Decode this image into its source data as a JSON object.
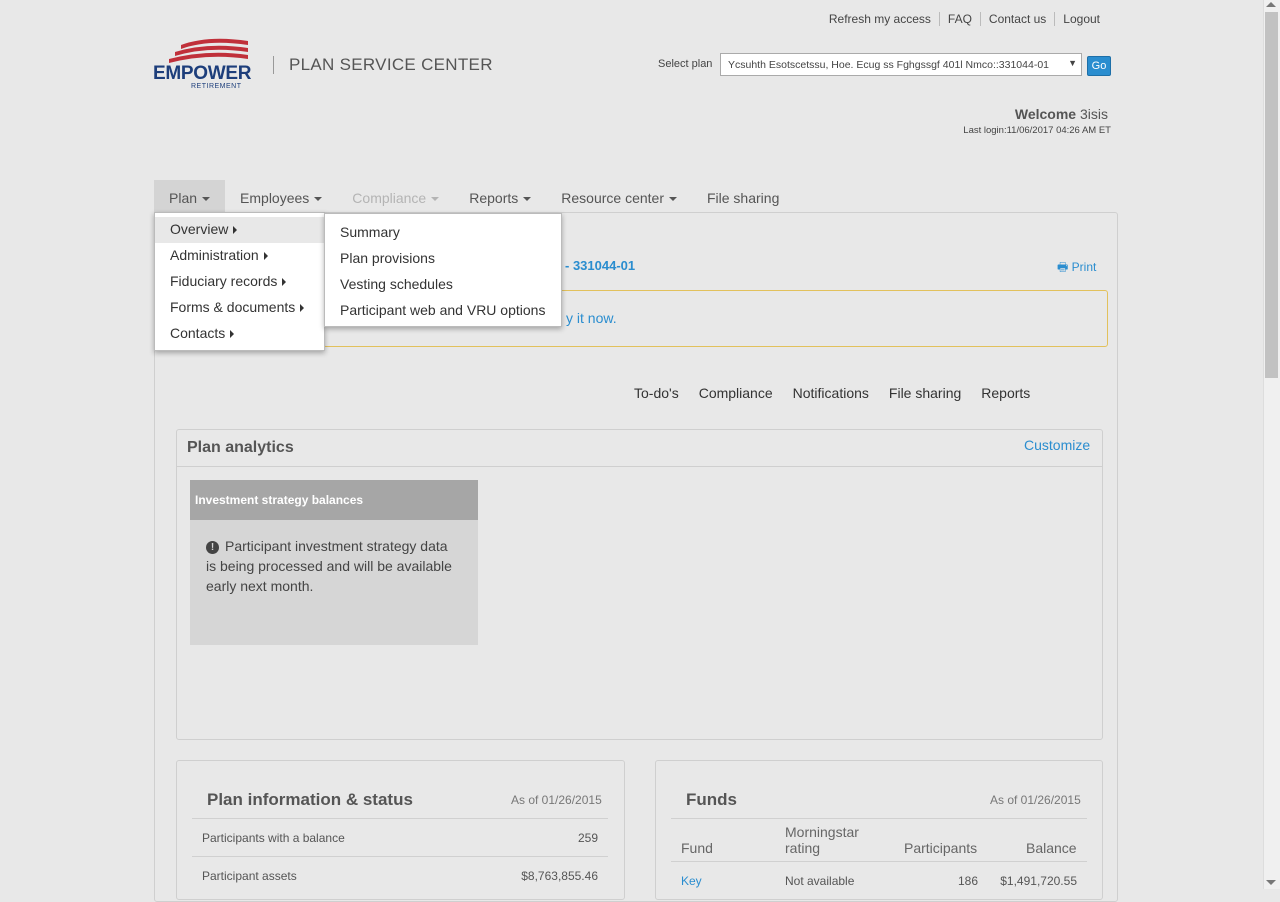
{
  "util_links": [
    "Refresh my access",
    "FAQ",
    "Contact us",
    "Logout"
  ],
  "brand": {
    "name": "EMPOWER",
    "sub": "RETIREMENT",
    "product": "PLAN SERVICE CENTER",
    "colors": {
      "navy": "#1d3e7b",
      "red": "#c0303a"
    }
  },
  "plan_select": {
    "label": "Select plan",
    "value": "Ycsuhth Esotscetssu, Hoe. Ecug ss Fghgssgf 401l Nmco::331044-01",
    "go": "Go"
  },
  "welcome": {
    "prefix": "Welcome",
    "user": "3isis",
    "last_login": "Last login:11/06/2017 04:26 AM ET"
  },
  "nav": [
    "Plan",
    "Employees",
    "Compliance",
    "Reports",
    "Resource center",
    "File sharing"
  ],
  "plan_id": "- 331044-01",
  "print": "Print",
  "alert_link": "y it now.",
  "subtabs": [
    "To-do's",
    "Compliance",
    "Notifications",
    "File sharing",
    "Reports"
  ],
  "analytics": {
    "title": "Plan analytics",
    "customize": "Customize",
    "card_title": "Investment strategy balances",
    "card_message": "Participant investment strategy data is being processed and will be available early next month."
  },
  "plan_info": {
    "title": "Plan information & status",
    "as_of": "As of 01/26/2015",
    "rows": [
      {
        "label": "Participants with a balance",
        "value": "259"
      },
      {
        "label": "Participant assets",
        "value": "$8,763,855.46"
      }
    ]
  },
  "funds": {
    "title": "Funds",
    "as_of": "As of 01/26/2015",
    "headers": {
      "fund": "Fund",
      "rating_1": "Morningstar",
      "rating_2": "rating",
      "participants": "Participants",
      "balance": "Balance"
    },
    "rows": [
      {
        "fund": "Key",
        "rating": "Not available",
        "participants": "186",
        "balance": "$1,491,720.55"
      }
    ]
  },
  "plan_menu": [
    "Overview",
    "Administration",
    "Fiduciary records",
    "Forms & documents",
    "Contacts"
  ],
  "overview_submenu": [
    "Summary",
    "Plan provisions",
    "Vesting schedules",
    "Participant web and VRU options"
  ]
}
